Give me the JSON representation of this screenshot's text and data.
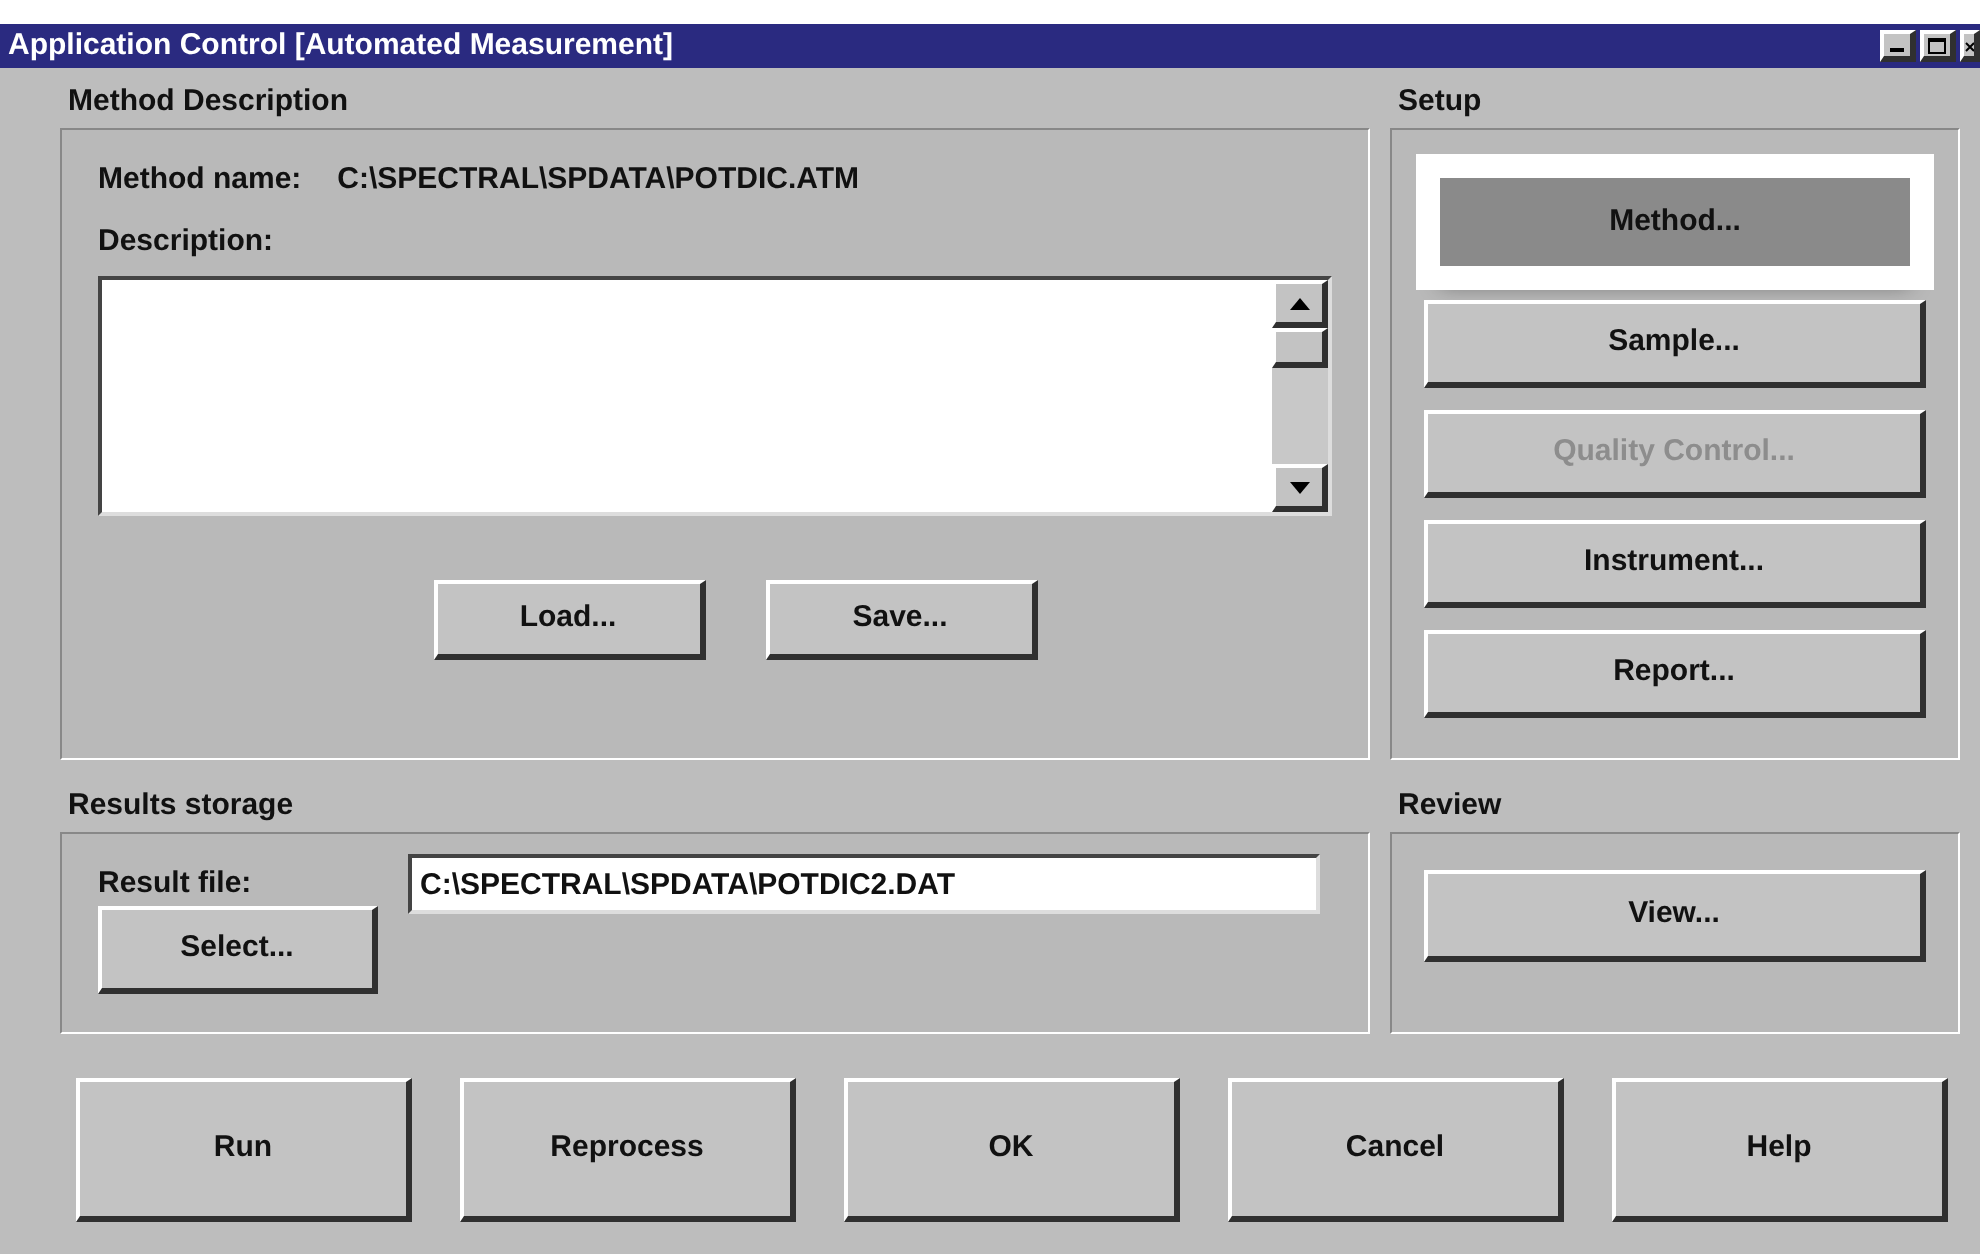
{
  "window": {
    "title": "Application Control [Automated Measurement]"
  },
  "method_description": {
    "title": "Method Description",
    "name_label": "Method name:",
    "name_value": "C:\\SPECTRAL\\SPDATA\\POTDIC.ATM",
    "description_label": "Description:",
    "buttons": [
      "Load...",
      "Save..."
    ]
  },
  "setup": {
    "title": "Setup",
    "buttons": [
      {
        "label": "Method...",
        "disabled": false,
        "focused": true
      },
      {
        "label": "Sample...",
        "disabled": false,
        "focused": false
      },
      {
        "label": "Quality Control...",
        "disabled": true,
        "focused": false
      },
      {
        "label": "Instrument...",
        "disabled": false,
        "focused": false
      },
      {
        "label": "Report...",
        "disabled": false,
        "focused": false
      }
    ]
  },
  "results_storage": {
    "title": "Results storage",
    "file_label": "Result file:",
    "file_value": "C:\\SPECTRAL\\SPDATA\\POTDIC2.DAT",
    "select_button": "Select..."
  },
  "review": {
    "title": "Review",
    "buttons": [
      "View..."
    ]
  },
  "footer_buttons": [
    "Run",
    "Reprocess",
    "OK",
    "Cancel",
    "Help"
  ]
}
